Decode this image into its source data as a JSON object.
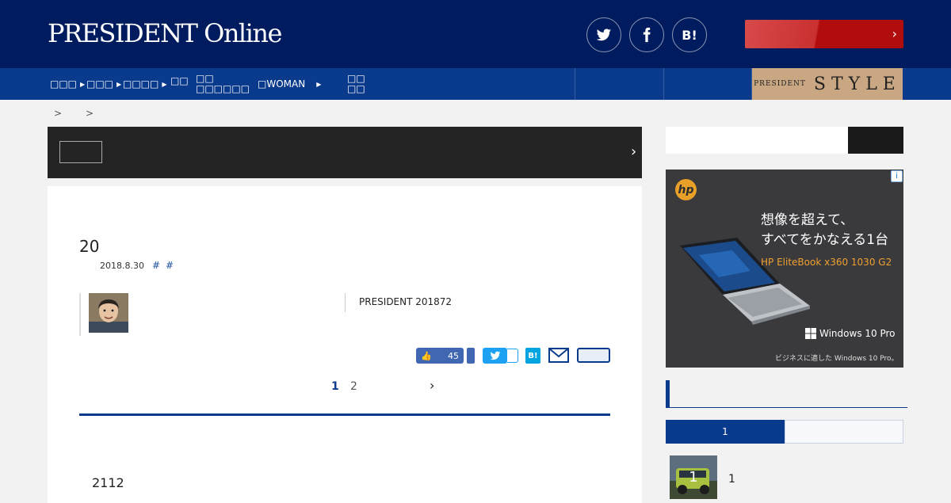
{
  "header": {
    "logo_text": "PRESIDENT Online",
    "social": [
      "twitter-icon",
      "facebook-icon",
      "hatena-bookmark-icon"
    ],
    "hatena_label": "B!",
    "cta_chevron": "›"
  },
  "nav": {
    "items": [
      {
        "label": "□□□",
        "has_arrow": true
      },
      {
        "label": "□□□",
        "has_arrow": true
      },
      {
        "label": "□□□□",
        "has_arrow": true
      },
      {
        "label": "□□",
        "has_arrow": false
      },
      {
        "label": "□□ □□□□□□",
        "has_arrow": false
      },
      {
        "label": "□WOMAN",
        "has_arrow": true
      },
      {
        "label": "□□ □□",
        "has_arrow": false
      }
    ],
    "style_banner": {
      "prefix": "PRESIDENT",
      "word": "STYLE"
    }
  },
  "breadcrumb": {
    "sep1": ">",
    "sep2": ">"
  },
  "banner": {
    "chevron": "›"
  },
  "article": {
    "title": "20",
    "date": "2018.8.30",
    "tags": [
      "#",
      "#"
    ],
    "source": "PRESIDENT 201872",
    "like_count": "45",
    "hatena_label": "B!",
    "pagination": {
      "pages": [
        "1",
        "2"
      ],
      "current": "1",
      "next": "›"
    },
    "body_start": "2112"
  },
  "ad": {
    "info": "i",
    "brand": "hp",
    "headline_1": "想像を超えて、",
    "headline_2": "すべてをかなえる1台",
    "model": "HP EliteBook x360 1030 G2",
    "windows": "Windows 10 Pro",
    "small": "ビジネスに適した Windows 10 Pro。"
  },
  "ranking": {
    "tab_active": "1",
    "first_rank": "1",
    "first_text": "1"
  },
  "colors": {
    "navy": "#001b5e",
    "nav_blue": "#0a3a8c",
    "red": "#b10d0d"
  }
}
